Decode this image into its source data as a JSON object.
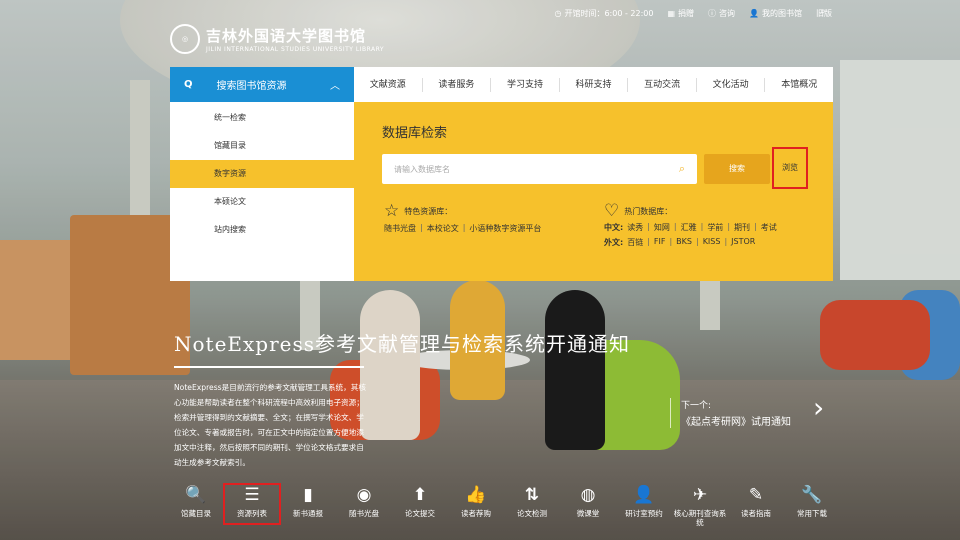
{
  "topbar": {
    "hours": "开馆时间：6:00 - 22:00",
    "donate": "捐赠",
    "consult": "咨询",
    "my_library": "我的图书馆",
    "old_version": "旧版"
  },
  "logo": {
    "name_cn": "吉林外国语大学图书馆",
    "name_en": "JILIN INTERNATIONAL STUDIES UNIVERSITY LIBRARY"
  },
  "leftnav": {
    "header": "搜索图书馆资源",
    "items": [
      {
        "label": "统一检索"
      },
      {
        "label": "馆藏目录"
      },
      {
        "label": "数字资源"
      },
      {
        "label": "本硕论文"
      },
      {
        "label": "站内搜索"
      }
    ]
  },
  "mainnav": {
    "items": [
      {
        "label": "文献资源"
      },
      {
        "label": "读者服务"
      },
      {
        "label": "学习支持"
      },
      {
        "label": "科研支持"
      },
      {
        "label": "互动交流"
      },
      {
        "label": "文化活动"
      },
      {
        "label": "本馆概况"
      }
    ]
  },
  "panel": {
    "title": "数据库检索",
    "placeholder": "请输入数据库名",
    "search_label": "搜索",
    "browse_label": "浏览",
    "featured": {
      "heading": "特色资源库：",
      "links": [
        "随书光盘",
        "本校论文",
        "小语种数字资源平台"
      ]
    },
    "hot": {
      "heading": "热门数据库：",
      "cn_label": "中文:",
      "cn_links": [
        "读秀",
        "知网",
        "汇雅",
        "学前",
        "期刊",
        "考试"
      ],
      "en_label": "外文:",
      "en_links": [
        "百链",
        "FIF",
        "BKS",
        "KISS",
        "JSTOR"
      ]
    }
  },
  "news": {
    "headline": "NoteExpress参考文献管理与检索系统开通通知",
    "description": "NoteExpress是目前流行的参考文献管理工具系统，其核心功能是帮助读者在整个科研流程中高效利用电子资源；检索并管理得到的文献摘要、全文；在撰写学术论文、学位论文、专著或报告时，可在正文中的指定位置方便地添加文中注释，然后按照不同的期刊、学位论文格式要求自动生成参考文献索引。",
    "next_label": "下一个:",
    "next_title": "《起点考研网》试用通知"
  },
  "quick_links": [
    {
      "label": "馆藏目录",
      "icon": "search-icon",
      "glyph": "🔍"
    },
    {
      "label": "资源列表",
      "icon": "list-icon",
      "glyph": "☰"
    },
    {
      "label": "新书通报",
      "icon": "book-icon",
      "glyph": "▮"
    },
    {
      "label": "随书光盘",
      "icon": "disc-icon",
      "glyph": "◉"
    },
    {
      "label": "论文提交",
      "icon": "upload-icon",
      "glyph": "⬆"
    },
    {
      "label": "读者荐购",
      "icon": "thumbs-up-icon",
      "glyph": "👍"
    },
    {
      "label": "论文检测",
      "icon": "sort-icon",
      "glyph": "⇅"
    },
    {
      "label": "微课堂",
      "icon": "globe-icon",
      "glyph": "◍"
    },
    {
      "label": "研讨室预约",
      "icon": "user-icon",
      "glyph": "👤"
    },
    {
      "label": "核心期刊查询系统",
      "icon": "plane-icon",
      "glyph": "✈"
    },
    {
      "label": "读者指南",
      "icon": "pencil-icon",
      "glyph": "✎"
    },
    {
      "label": "常用下载",
      "icon": "wrench-icon",
      "glyph": "🔧"
    }
  ]
}
